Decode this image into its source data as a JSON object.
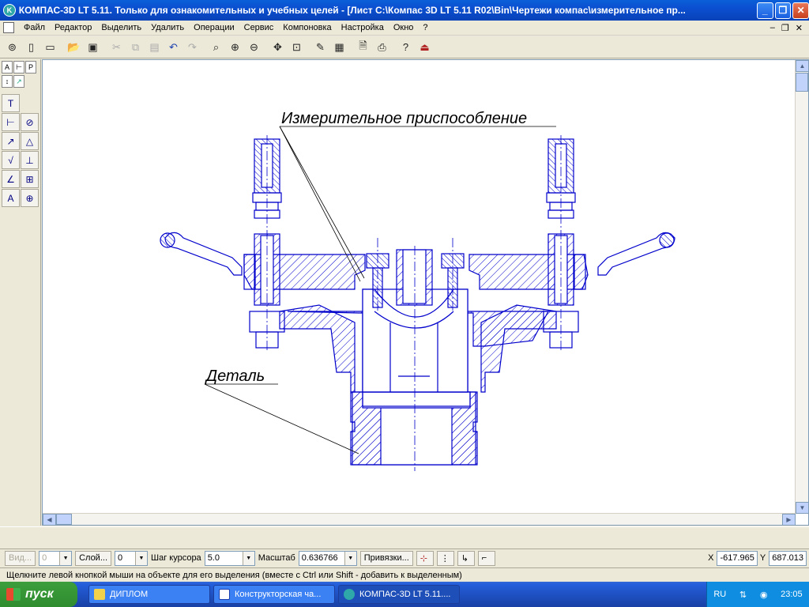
{
  "window": {
    "title": "КОМПАС-3D LT 5.11. Только для ознакомительных и учебных целей - [Лист C:\\Компас 3D LT 5.11 R02\\Bin\\Чертежи компас\\измерительное пр...",
    "app_icon_letter": "K"
  },
  "menu": {
    "items": [
      "Файл",
      "Редактор",
      "Выделить",
      "Удалить",
      "Операции",
      "Сервис",
      "Компоновка",
      "Настройка",
      "Окно",
      "?"
    ]
  },
  "drawing": {
    "label_top": "Измерительное приспособление",
    "label_bottom": "Деталь",
    "line_color": "#0000cc",
    "text_color": "#000000"
  },
  "properties": {
    "view_label": "Вид...",
    "view_value": "0",
    "layer_label": "Слой...",
    "layer_value": "0",
    "step_label": "Шаг курсора",
    "step_value": "5.0",
    "scale_label": "Масштаб",
    "scale_value": "0.636766",
    "snap_label": "Привязки...",
    "x_label": "X",
    "x_value": "-617.965",
    "y_label": "Y",
    "y_value": "687.013"
  },
  "status": {
    "text": "Щелкните левой кнопкой мыши на объекте для его выделения (вместе с Ctrl или Shift - добавить к выделенным)"
  },
  "taskbar": {
    "start_label": "пуск",
    "tasks": [
      {
        "label": "ДИПЛОМ",
        "icon": "folder-icon"
      },
      {
        "label": "Конструкторская ча...",
        "icon": "word-icon"
      },
      {
        "label": "КОМПАС-3D LT 5.11....",
        "icon": "kompas-icon"
      }
    ],
    "lang": "RU",
    "clock": "23:05"
  }
}
